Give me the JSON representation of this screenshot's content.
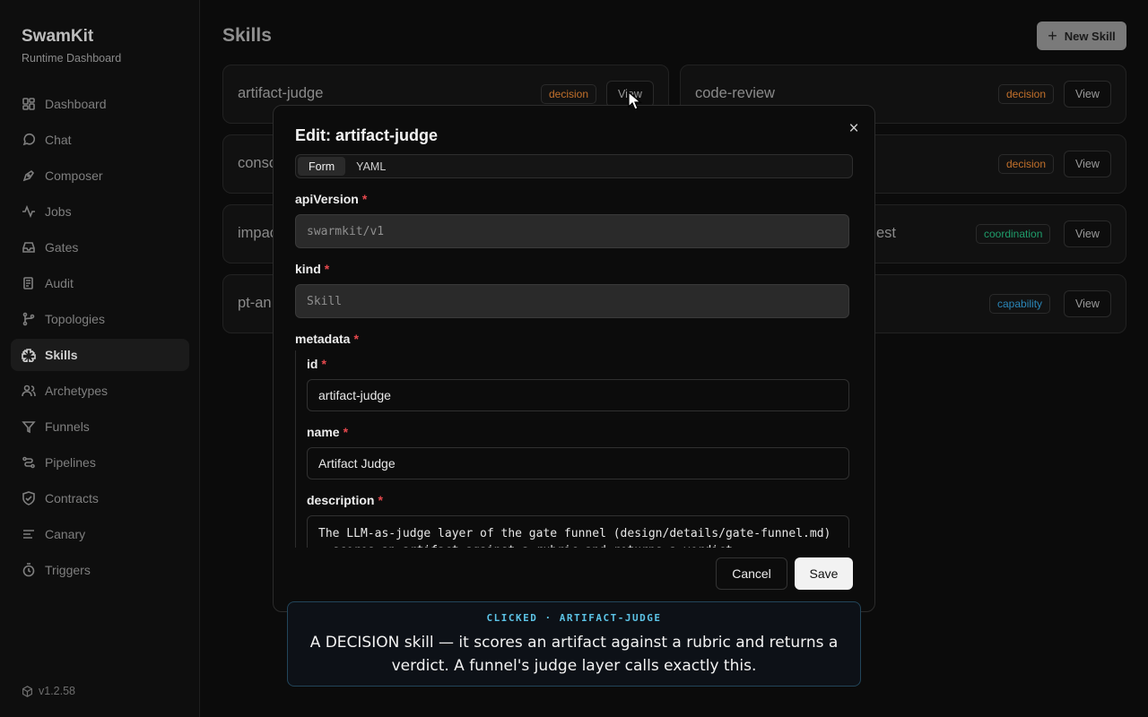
{
  "app": {
    "title": "SwamKit",
    "subtitle": "Runtime Dashboard",
    "version": "v1.2.58"
  },
  "sidebar": {
    "items": [
      {
        "label": "Dashboard",
        "icon": "dashboard-icon"
      },
      {
        "label": "Chat",
        "icon": "chat-icon"
      },
      {
        "label": "Composer",
        "icon": "composer-icon"
      },
      {
        "label": "Jobs",
        "icon": "jobs-icon"
      },
      {
        "label": "Gates",
        "icon": "gates-icon"
      },
      {
        "label": "Audit",
        "icon": "audit-icon"
      },
      {
        "label": "Topologies",
        "icon": "topologies-icon"
      },
      {
        "label": "Skills",
        "icon": "skills-icon",
        "active": true
      },
      {
        "label": "Archetypes",
        "icon": "archetypes-icon"
      },
      {
        "label": "Funnels",
        "icon": "funnels-icon"
      },
      {
        "label": "Pipelines",
        "icon": "pipelines-icon"
      },
      {
        "label": "Contracts",
        "icon": "contracts-icon"
      },
      {
        "label": "Canary",
        "icon": "canary-icon"
      },
      {
        "label": "Triggers",
        "icon": "triggers-icon"
      }
    ]
  },
  "header": {
    "title": "Skills",
    "new_button": "New Skill"
  },
  "cards": [
    {
      "name": "artifact-judge",
      "badge": "decision",
      "badge_color": "#c2702b",
      "view": "View"
    },
    {
      "name": "code-review",
      "badge": "decision",
      "badge_color": "#c2702b",
      "view": "View"
    },
    {
      "name": "conso",
      "badge": "",
      "view": ""
    },
    {
      "name": "",
      "badge": "decision",
      "badge_color": "#c2702b",
      "view": "View"
    },
    {
      "name": "impac",
      "badge": "",
      "view": ""
    },
    {
      "name": "est",
      "badge": "coordination",
      "badge_color": "#1f9d6b",
      "view": "View"
    },
    {
      "name": "pt-an",
      "badge": "",
      "view": ""
    },
    {
      "name": "",
      "badge": "capability",
      "badge_color": "#2a86b8",
      "view": "View"
    }
  ],
  "modal": {
    "title": "Edit: artifact-judge",
    "tabs": [
      "Form",
      "YAML"
    ],
    "fields": {
      "apiVersion": {
        "label": "apiVersion",
        "value": "swarmkit/v1"
      },
      "kind": {
        "label": "kind",
        "value": "Skill"
      },
      "metadata": {
        "label": "metadata"
      },
      "id": {
        "label": "id",
        "value": "artifact-judge"
      },
      "name": {
        "label": "name",
        "value": "Artifact Judge"
      },
      "description": {
        "label": "description",
        "value": "The LLM-as-judge layer of the gate funnel (design/details/gate-funnel.md) — scores an artifact against a rubric and returns a verdict."
      }
    },
    "required_mark": "*",
    "cancel": "Cancel",
    "save": "Save"
  },
  "callout": {
    "tag": "CLICKED · ARTIFACT-JUDGE",
    "text": "A DECISION skill — it scores an artifact against a rubric and returns a verdict. A funnel's judge layer calls exactly this."
  },
  "colors": {
    "required": "#e5484d",
    "callout_accent": "#5cc3e6"
  }
}
